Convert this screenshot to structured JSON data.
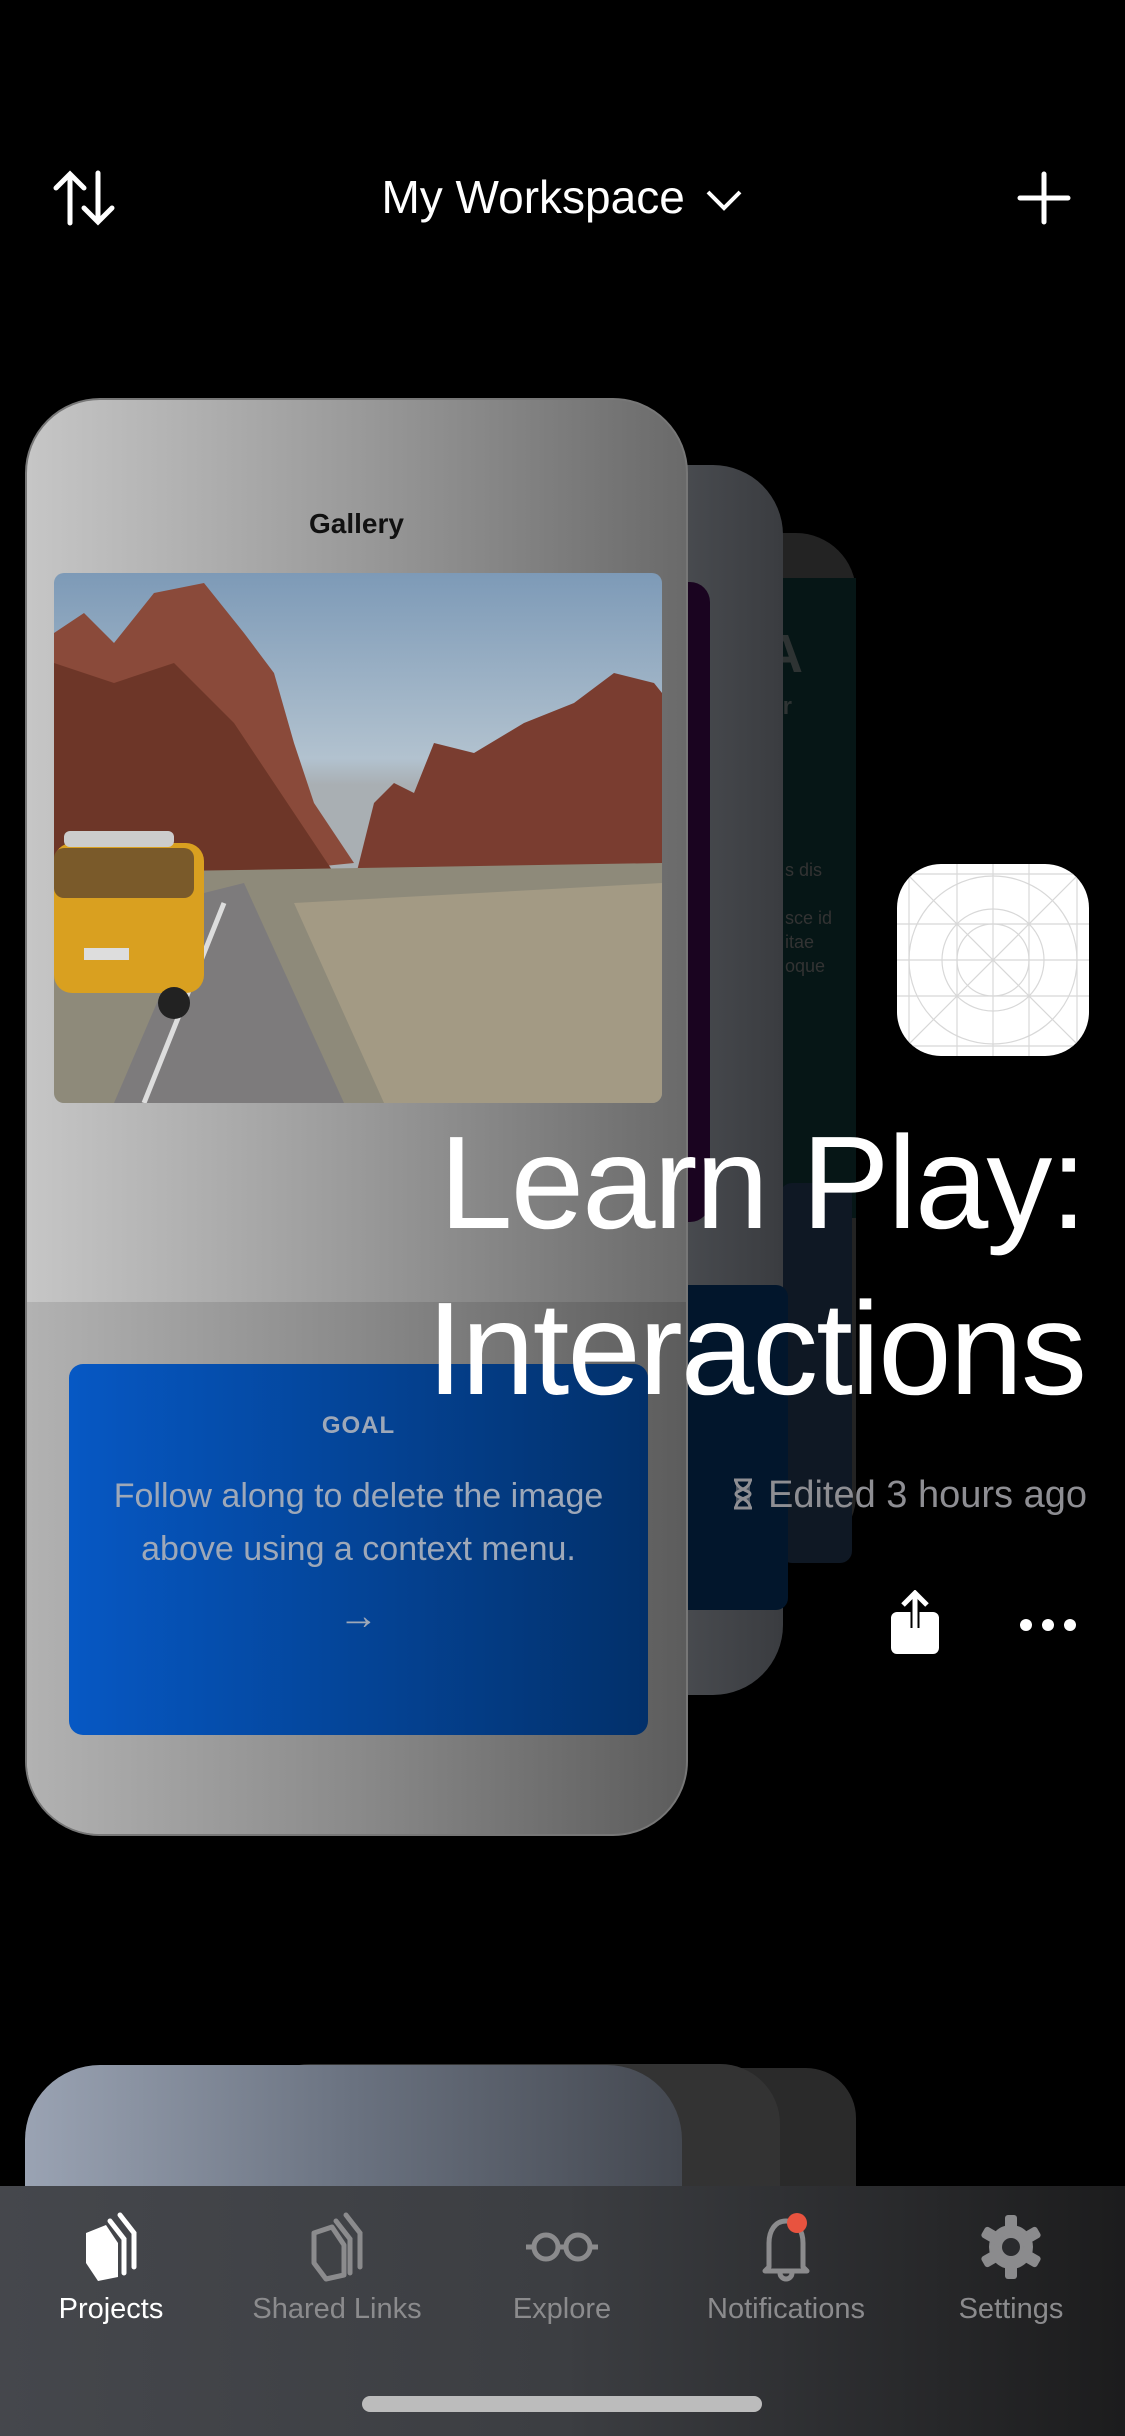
{
  "header": {
    "title": "My Workspace",
    "sort_icon": "sort-arrows-icon",
    "add_icon": "plus-icon"
  },
  "project": {
    "title_line1": "Learn Play:",
    "title_line2": "Interactions",
    "edited": "Edited 3 hours ago",
    "preview": {
      "gallery_title": "Gallery",
      "goal_label": "GOAL",
      "goal_text": "Follow along to delete the image above using a context menu.",
      "goal_arrow": "→"
    },
    "back_card_fragments": [
      "A",
      "Gr",
      "s dis",
      "sce id",
      "itae",
      "oque"
    ]
  },
  "tabs": [
    {
      "label": "Projects",
      "icon": "projects-stack-icon",
      "active": true
    },
    {
      "label": "Shared Links",
      "icon": "shared-links-icon",
      "active": false
    },
    {
      "label": "Explore",
      "icon": "glasses-icon",
      "active": false
    },
    {
      "label": "Notifications",
      "icon": "bell-icon",
      "active": false,
      "badge": true
    },
    {
      "label": "Settings",
      "icon": "gear-icon",
      "active": false
    }
  ],
  "colors": {
    "background": "#000000",
    "goal_blue": "#0658c4",
    "badge": "#e8533f",
    "inactive_tab": "#8b8b8d"
  }
}
